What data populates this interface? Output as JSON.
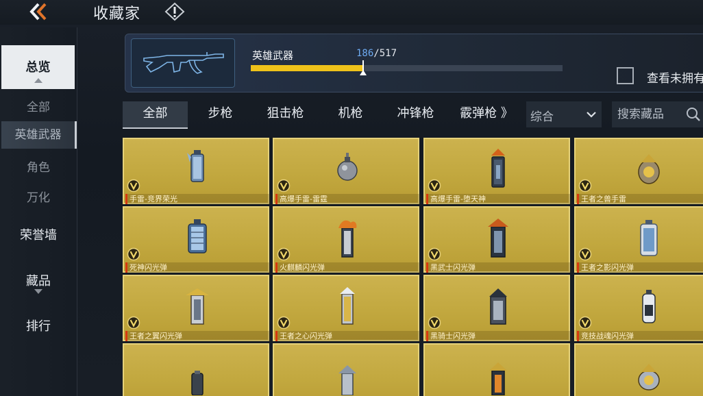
{
  "header": {
    "title": "收藏家",
    "back_icon": "double-chevron-left-icon",
    "info_icon": "exclamation-diamond-icon"
  },
  "sidebar": {
    "overview_label": "总览",
    "sub_items": [
      "全部",
      "英雄武器",
      "角色",
      "万化"
    ],
    "selected_sub": "英雄武器",
    "main_items": [
      "荣誉墙",
      "藏品",
      "排行"
    ]
  },
  "banner": {
    "category_label": "英雄武器",
    "owned": "186",
    "separator": "/",
    "total": "517",
    "progress_fraction": 0.36,
    "show_unowned_label": "查看未拥有"
  },
  "tabs": [
    "全部",
    "步枪",
    "狙击枪",
    "机枪",
    "冲锋枪",
    "霰弹枪 》"
  ],
  "sort": {
    "value": "综合"
  },
  "search": {
    "placeholder": "搜索藏品"
  },
  "items": [
    "手雷-竞界荣光",
    "高爆手雷-雷霆",
    "高爆手雷-堕天神",
    "王者之兽手雷",
    "死神闪光弹",
    "火麒麟闪光弹",
    "黑武士闪光弹",
    "王者之影闪光弹",
    "王者之翼闪光弹",
    "王者之心闪光弹",
    "黑骑士闪光弹",
    "竞技战魂闪光弹",
    "",
    "",
    "",
    ""
  ],
  "colors": {
    "card_gold": "#c2a83f",
    "progress_yellow": "#efc21a",
    "count_blue": "#6eaaf1"
  }
}
